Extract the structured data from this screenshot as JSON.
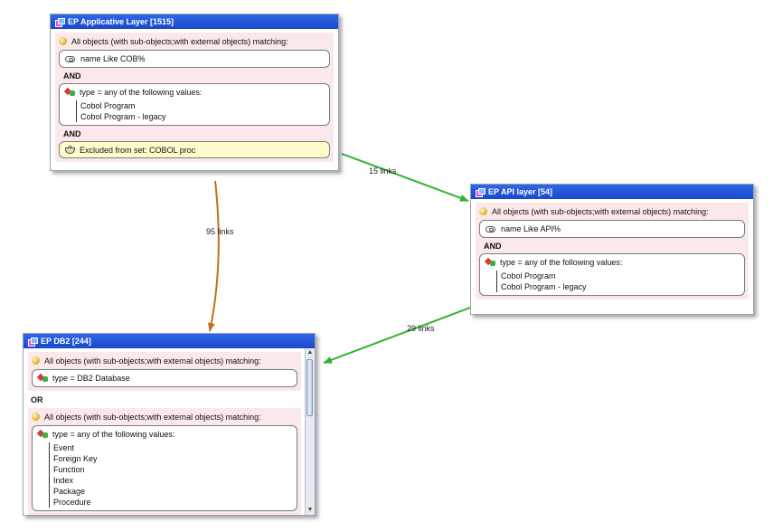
{
  "links": [
    {
      "label": "15 links",
      "color": "#2db52d"
    },
    {
      "label": "95 links",
      "color": "#c2701c"
    },
    {
      "label": "29 links",
      "color": "#2db52d"
    }
  ],
  "nodes": {
    "applicative": {
      "title": "EP Applicative Layer [1515]",
      "group_header": "All objects (with sub-objects;with external objects) matching:",
      "criterion_name": "name Like COB%",
      "and1": "AND",
      "type_header": "type = any of the following values:",
      "values": [
        "Cobol Program",
        "Cobol Program - legacy"
      ],
      "and2": "AND",
      "excluded": "Excluded from set: COBOL proc"
    },
    "api": {
      "title": "EP API layer [54]",
      "group_header": "All objects (with sub-objects;with external objects) matching:",
      "criterion_name": "name Like API%",
      "and1": "AND",
      "type_header": "type = any of the following values:",
      "values": [
        "Cobol Program",
        "Cobol Program - legacy"
      ]
    },
    "db2": {
      "title": "EP DB2 [244]",
      "group1_header": "All objects (with sub-objects;with external objects) matching:",
      "type1": "type = DB2 Database",
      "or": "OR",
      "group2_header": "All objects (with sub-objects;with external objects) matching:",
      "type2_header": "type = any of the following values:",
      "values": [
        "Event",
        "Foreign Key",
        "Function",
        "Index",
        "Package",
        "Procedure"
      ]
    }
  }
}
